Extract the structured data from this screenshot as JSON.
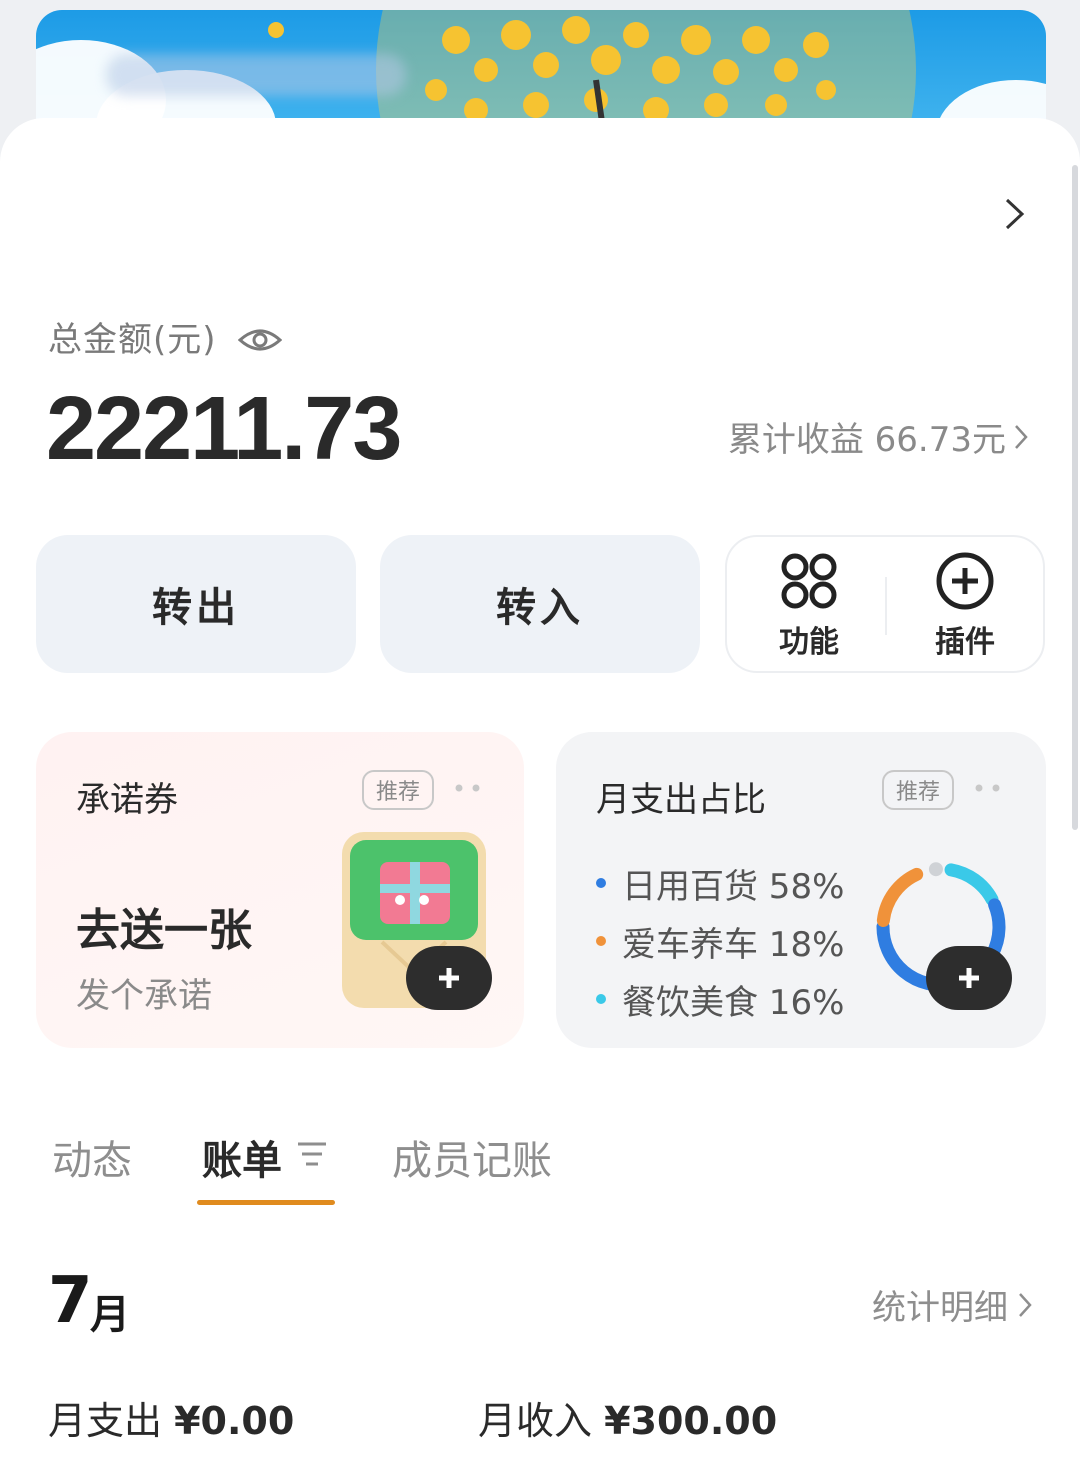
{
  "summary": {
    "total_label": "总金额(元)",
    "total_amount": "22211.73",
    "earnings_text": "累计收益 66.73元"
  },
  "actions": {
    "transfer_out": "转出",
    "transfer_in": "转入",
    "functions": "功能",
    "plugins": "插件"
  },
  "widgets": {
    "promise": {
      "title": "承诺券",
      "badge": "推荐",
      "headline": "去送一张",
      "subtext": "发个承诺"
    },
    "spending": {
      "title": "月支出占比",
      "badge": "推荐",
      "items": [
        {
          "label": "日用百货 58%",
          "share": 58,
          "color": "#2f7de1"
        },
        {
          "label": "爱车养车 18%",
          "share": 18,
          "color": "#f0923a"
        },
        {
          "label": "餐饮美食 16%",
          "share": 16,
          "color": "#3ac9e8"
        }
      ]
    }
  },
  "tabs": [
    {
      "label": "动态",
      "active": false
    },
    {
      "label": "账单",
      "active": true
    },
    {
      "label": "成员记账",
      "active": false
    }
  ],
  "month": {
    "number": "7",
    "unit": "月",
    "stats_link": "统计明细",
    "expense_label": "月支出",
    "expense_value": "¥0.00",
    "income_label": "月收入",
    "income_value": "¥300.00"
  },
  "colors": {
    "accent_underline": "#e08b1e",
    "button_bg": "#eef2f7",
    "banner_blue": "#1d9be6",
    "flower_yellow": "#f6c331"
  }
}
